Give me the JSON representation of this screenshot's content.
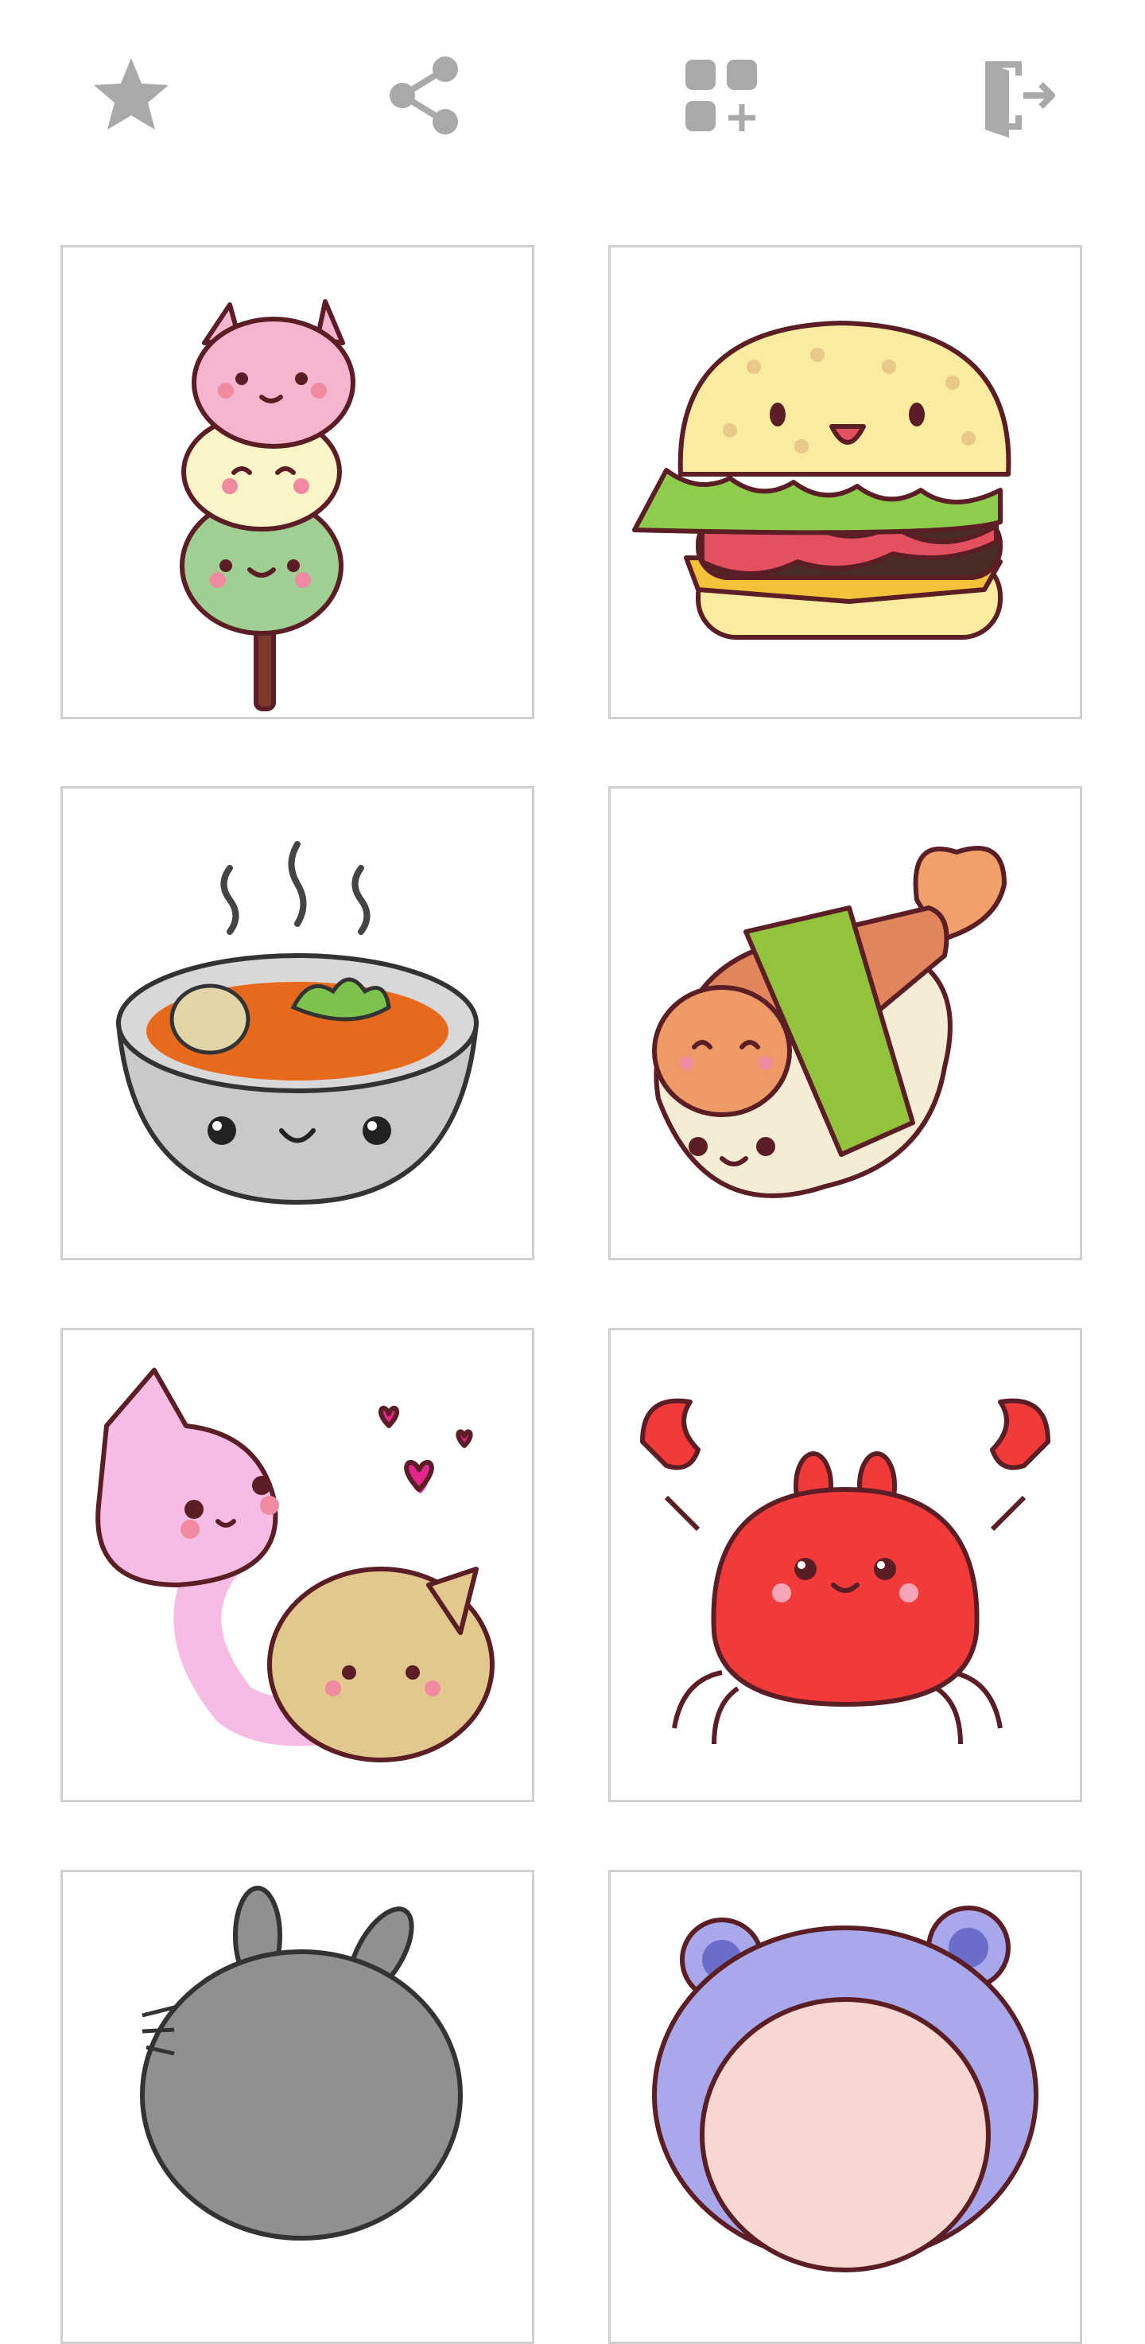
{
  "toolbar": {
    "buttons": [
      {
        "id": "favorites",
        "icon": "star-icon"
      },
      {
        "id": "share",
        "icon": "share-icon"
      },
      {
        "id": "more-apps",
        "icon": "apps-add-icon"
      },
      {
        "id": "exit",
        "icon": "exit-door-icon"
      }
    ],
    "icon_color": "#a9a9a9"
  },
  "gallery": {
    "tile_border_color": "#cfcfcf",
    "items": [
      {
        "subject": "dango-cat-skewer"
      },
      {
        "subject": "hamburger"
      },
      {
        "subject": "soup-bowl"
      },
      {
        "subject": "shrimp-sushi"
      },
      {
        "subject": "pink-and-beige-cats"
      },
      {
        "subject": "red-crab"
      },
      {
        "subject": "grey-totoro"
      },
      {
        "subject": "purple-bear-hood"
      }
    ]
  }
}
